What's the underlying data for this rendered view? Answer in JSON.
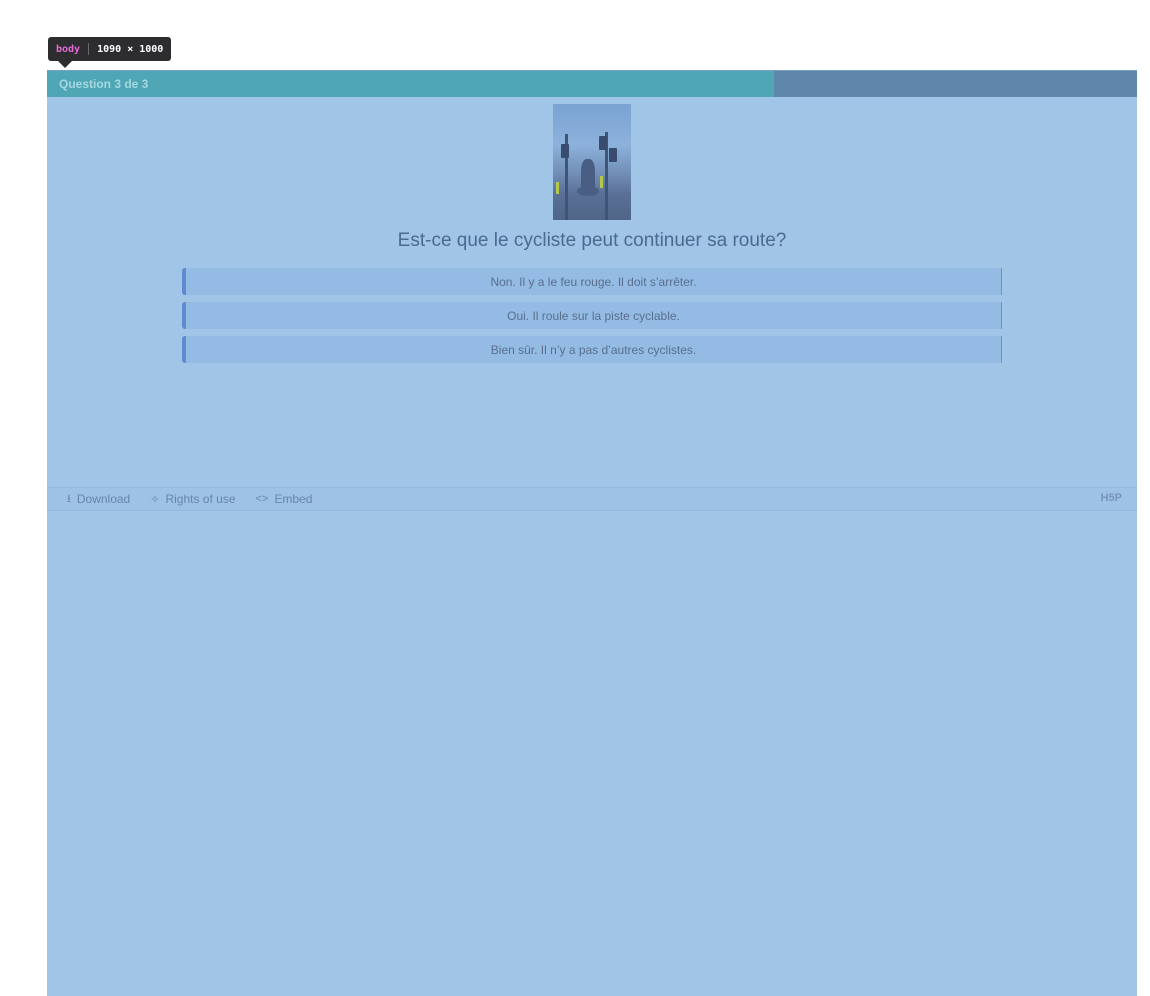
{
  "inspector": {
    "tag": "body",
    "size": "1090 × 1000"
  },
  "progress": {
    "label": "Question 3 de 3",
    "fraction": 0.667,
    "fill_color": "#4fa6b4",
    "track_color": "#5f87ab"
  },
  "question": {
    "title": "Est-ce que le cycliste peut continuer sa route?"
  },
  "answers": [
    {
      "label": "Non. Il y a le feu rouge. Il doit s’arrêter."
    },
    {
      "label": "Oui. Il roule sur la piste cyclable."
    },
    {
      "label": "Bien sûr. Il n’y a pas d’autres cyclistes."
    }
  ],
  "footer": {
    "download_label": "Download",
    "rights_label": "Rights of use",
    "embed_label": "Embed",
    "logo": "H5P",
    "icons": {
      "download": "download-icon",
      "rights": "handshake-icon",
      "embed": "code-icon"
    }
  },
  "colors": {
    "overlay": "#a0c5e7",
    "answer_bg": "#93bbe4",
    "answer_accent": "#5d8ad0"
  }
}
